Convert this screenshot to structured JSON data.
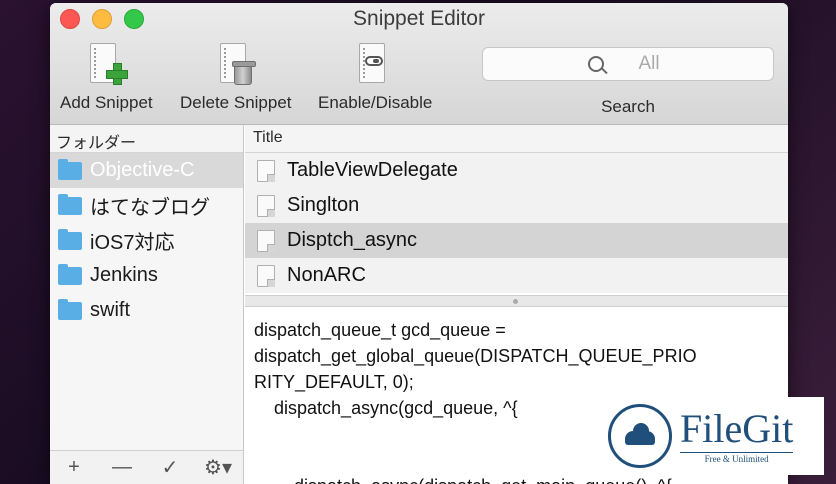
{
  "window": {
    "title": "Snippet Editor"
  },
  "toolbar": {
    "add_label": "Add Snippet",
    "delete_label": "Delete Snippet",
    "enable_label": "Enable/Disable",
    "search_label": "Search",
    "search_placeholder": "All"
  },
  "sidebar": {
    "header": "フォルダー",
    "items": [
      {
        "label": "Objective-C",
        "selected": true
      },
      {
        "label": "はてなブログ"
      },
      {
        "label": "iOS7対応"
      },
      {
        "label": "Jenkins"
      },
      {
        "label": "swift"
      }
    ],
    "footer": {
      "add": "+",
      "remove": "—",
      "check": "✓",
      "gear": "⚙▾"
    }
  },
  "snippets": {
    "header": "Title",
    "items": [
      {
        "title": "TableViewDelegate"
      },
      {
        "title": "Singlton"
      },
      {
        "title": "Disptch_async",
        "selected": true
      },
      {
        "title": "NonARC"
      }
    ]
  },
  "editor": {
    "content": "dispatch_queue_t gcd_queue =\ndispatch_get_global_queue(DISPATCH_QUEUE_PRIO\nRITY_DEFAULT, 0);\n    dispatch_async(gcd_queue, ^{\n\n\n        dispatch_async(dispatch_get_main_queue(), ^{"
  },
  "watermark": {
    "title": "FileGit",
    "subtitle": "Free & Unlimited"
  },
  "colors": {
    "folder": "#5aaee6",
    "selection": "#d4d4d4",
    "brand": "#1f4f7a"
  }
}
